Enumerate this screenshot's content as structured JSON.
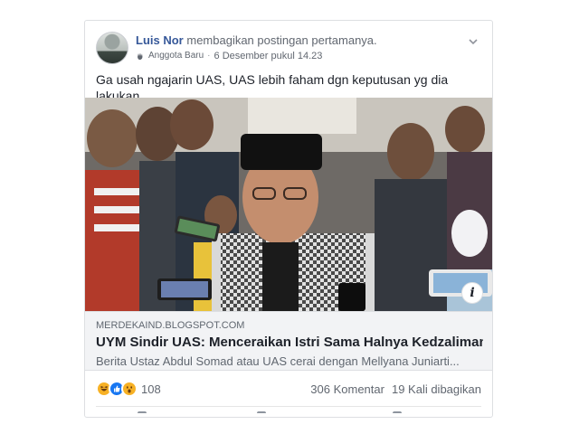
{
  "post": {
    "author_name": "Luis Nor",
    "action_text": "membagikan postingan pertamanya.",
    "badge_label": "Anggota Baru",
    "time_text": "6 Desember pukul 14.23",
    "text": "Ga usah ngajarin UAS, UAS lebih faham dgn keputusan yg dia lakukan."
  },
  "link": {
    "info_label": "i",
    "domain": "MERDEKAIND.BLOGSPOT.COM",
    "title": "UYM Sindir UAS: Menceraikan Istri Sama Halnya Kedzaliman",
    "description": "Berita Ustaz Abdul Somad atau UAS cerai dengan Mellyana Juniarti..."
  },
  "engagement": {
    "reactions": [
      "haha",
      "like",
      "wow"
    ],
    "reaction_count": "108",
    "comments": "306 Komentar",
    "shares": "19 Kali dibagikan"
  },
  "colors": {
    "link_blue": "#365899",
    "like_blue": "#1877f2",
    "reaction_yellow": "#f7b125"
  }
}
